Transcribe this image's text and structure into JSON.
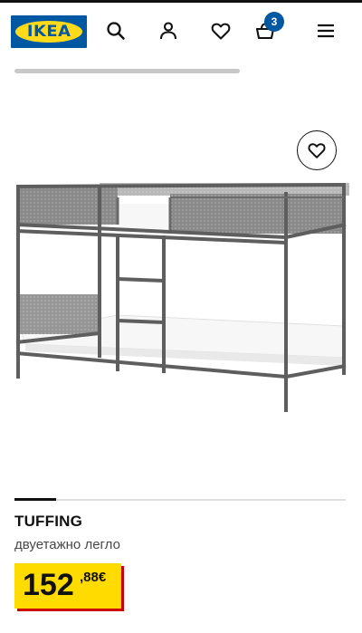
{
  "header": {
    "logo_text": "IKEA",
    "cart_count": "3",
    "icons": [
      "search-icon",
      "user-icon",
      "heart-icon",
      "cart-icon",
      "menu-icon"
    ]
  },
  "product": {
    "name": "TUFFING",
    "description": "двуетажно легло",
    "price_integer": "152",
    "price_decimal": ",88€"
  },
  "colors": {
    "ikea_blue": "#0058a3",
    "ikea_yellow": "#ffda1a",
    "price_tag_yellow": "#ffdb00",
    "price_tag_shadow": "#cc0008"
  }
}
